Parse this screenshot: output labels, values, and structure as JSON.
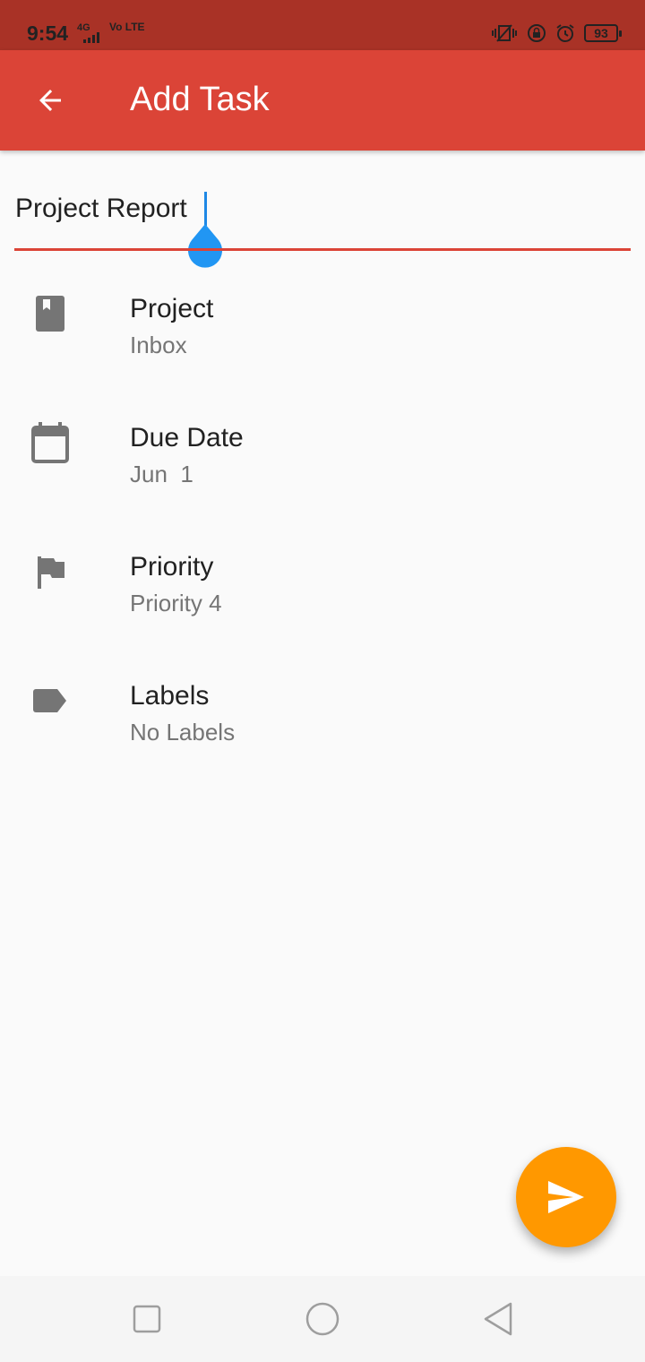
{
  "status_bar": {
    "time": "9:54",
    "network": "4G",
    "volte": "Vo LTE",
    "battery": "93"
  },
  "app_bar": {
    "title": "Add Task",
    "back_icon": "arrow-left-icon"
  },
  "task_title": {
    "value": "Project Report"
  },
  "options": [
    {
      "icon": "book-icon",
      "title": "Project",
      "value": "Inbox"
    },
    {
      "icon": "calendar-icon",
      "title": "Due Date",
      "value": "Jun  1"
    },
    {
      "icon": "flag-icon",
      "title": "Priority",
      "value": "Priority 4"
    },
    {
      "icon": "label-icon",
      "title": "Labels",
      "value": "No Labels"
    }
  ],
  "fab": {
    "icon": "send-icon"
  },
  "colors": {
    "status_bar": "#a93226",
    "app_bar": "#db4437",
    "fab": "#ff9800",
    "cursor": "#1e88e5"
  }
}
